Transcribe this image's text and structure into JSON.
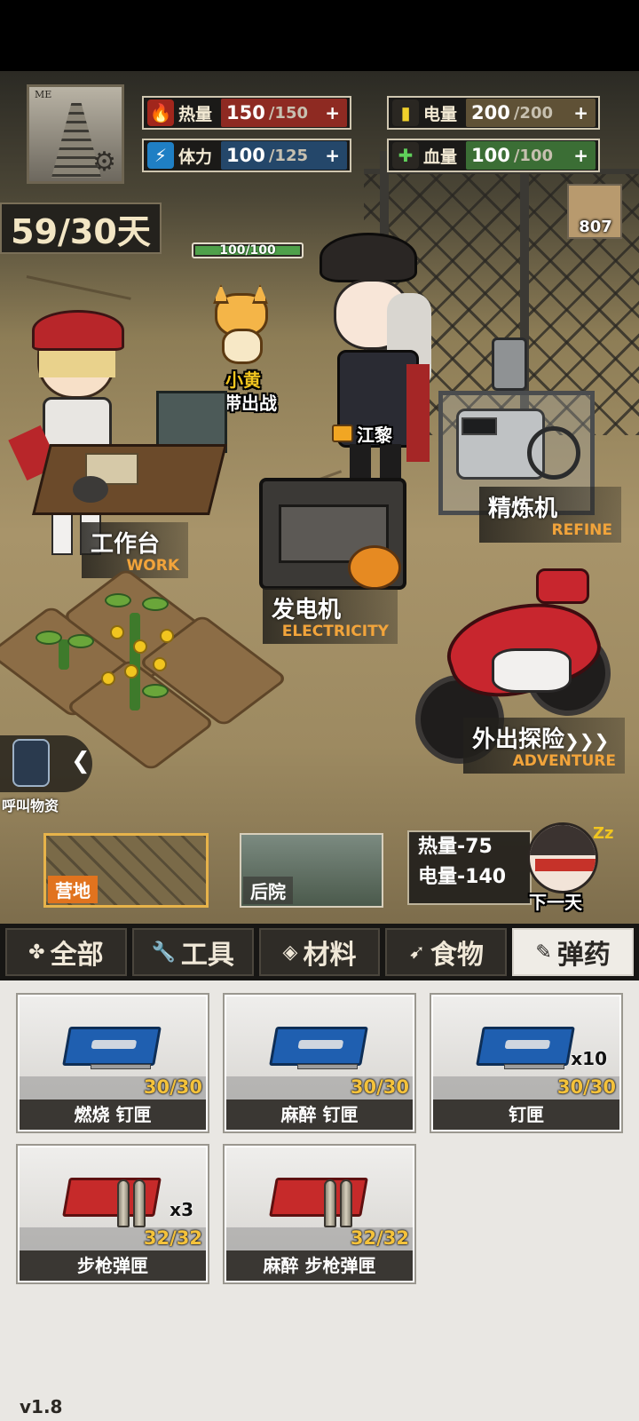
{
  "stats": {
    "heat": {
      "label": "热量",
      "current": "150",
      "max": "/150",
      "plus": "+",
      "icon": "flame-icon",
      "color": "#8e2a22"
    },
    "stamina": {
      "label": "体力",
      "current": "100",
      "max": "/125",
      "plus": "+",
      "icon": "lightning-icon",
      "color": "#24476a"
    },
    "power": {
      "label": "电量",
      "current": "200",
      "max": "/200",
      "plus": "+",
      "icon": "battery-icon",
      "color": "#5f5136"
    },
    "blood": {
      "label": "血量",
      "current": "100",
      "max": "/100",
      "plus": "+",
      "icon": "blood-drop-icon",
      "color": "#3b6e35"
    }
  },
  "profile": {
    "photo_tag": "ME"
  },
  "day_counter": "59/30天",
  "notes_count": "807",
  "pet": {
    "hp": "100/100",
    "hp_fraction": 1.0,
    "name": "小黄",
    "action": "携带出战"
  },
  "characters": {
    "officer_name": "江黎"
  },
  "stations": {
    "workbench": {
      "cn": "工作台",
      "en": "WORK"
    },
    "generator": {
      "cn": "发电机",
      "en": "ELECTRICITY"
    },
    "refiner": {
      "cn": "精炼机",
      "en": "REFINE"
    },
    "adventure": {
      "cn": "外出探险",
      "en": "ADVENTURE",
      "arrows": "❯❯❯"
    }
  },
  "call_supplies": {
    "label": "呼叫物资",
    "arrow": "❮"
  },
  "locations": [
    {
      "name": "营地",
      "active": true
    },
    {
      "name": "后院",
      "active": false
    }
  ],
  "next_day": {
    "heat_cost": "热量-75",
    "power_cost": "电量-140",
    "label": "下一天",
    "zz": "Zz"
  },
  "tabs": [
    {
      "label": "全部",
      "icon": "✤",
      "active": false
    },
    {
      "label": "工具",
      "icon": "🔧",
      "active": false
    },
    {
      "label": "材料",
      "icon": "◈",
      "active": false
    },
    {
      "label": "食物",
      "icon": "➹",
      "active": false
    },
    {
      "label": "弹药",
      "icon": "✎",
      "active": true
    }
  ],
  "items": [
    {
      "name": "燃烧 钉匣",
      "count": "30/30",
      "mult": "",
      "kind": "nail-box"
    },
    {
      "name": "麻醉 钉匣",
      "count": "30/30",
      "mult": "",
      "kind": "nail-box"
    },
    {
      "name": "钉匣",
      "count": "30/30",
      "mult": "x10",
      "kind": "nail-box"
    },
    {
      "name": "步枪弹匣",
      "count": "32/32",
      "mult": "x3",
      "kind": "rifle-magazine"
    },
    {
      "name": "麻醉 步枪弹匣",
      "count": "32/32",
      "mult": "",
      "kind": "rifle-magazine"
    }
  ],
  "version": "v1.8"
}
